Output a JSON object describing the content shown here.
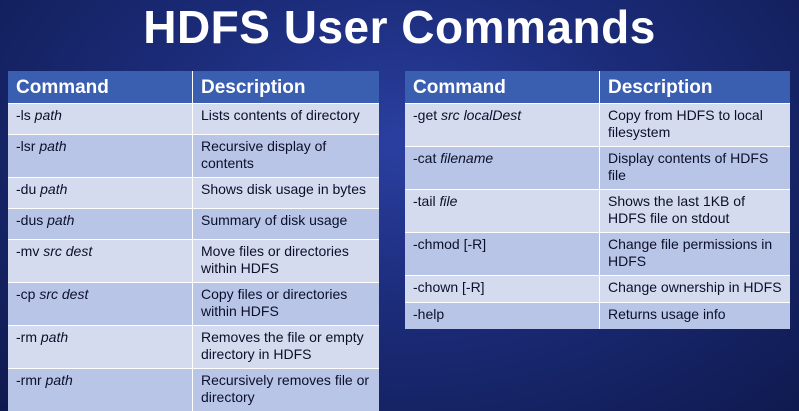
{
  "title": "HDFS User Commands",
  "headers": {
    "command": "Command",
    "description": "Description"
  },
  "left_table": [
    {
      "cmd": "-ls",
      "arg": "path",
      "desc": "Lists contents of directory"
    },
    {
      "cmd": "-lsr",
      "arg": "path",
      "desc": "Recursive display of contents"
    },
    {
      "cmd": "-du",
      "arg": "path",
      "desc": "Shows disk usage in bytes"
    },
    {
      "cmd": "-dus",
      "arg": "path",
      "desc": "Summary of disk usage"
    },
    {
      "cmd": "-mv",
      "arg": "src dest",
      "desc": "Move files or directories within HDFS"
    },
    {
      "cmd": "-cp",
      "arg": "src dest",
      "desc": "Copy files  or directories within HDFS"
    },
    {
      "cmd": "-rm",
      "arg": "path",
      "desc": "Removes the file or empty directory in HDFS"
    },
    {
      "cmd": "-rmr",
      "arg": "path",
      "desc": "Recursively removes file or directory"
    }
  ],
  "right_table": [
    {
      "cmd": "-get",
      "arg": "src localDest",
      "desc": "Copy from HDFS to local filesystem"
    },
    {
      "cmd": "-cat",
      "arg": "filename",
      "desc": "Display contents of HDFS file"
    },
    {
      "cmd": "-tail",
      "arg": "file",
      "desc": "Shows the last 1KB of HDFS file on stdout"
    },
    {
      "cmd": "-chmod [-R]",
      "arg": "",
      "desc": "Change file permissions in HDFS"
    },
    {
      "cmd": "-chown [-R]",
      "arg": "",
      "desc": "Change ownership in HDFS"
    },
    {
      "cmd": "-help",
      "arg": "",
      "desc": "Returns usage info"
    }
  ]
}
